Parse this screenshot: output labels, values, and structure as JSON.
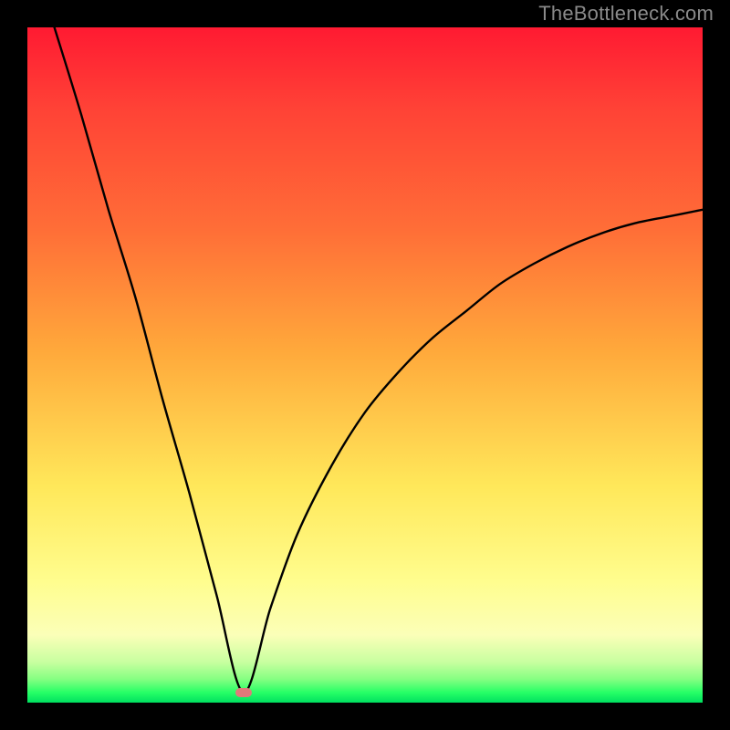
{
  "attribution": "TheBottleneck.com",
  "colors": {
    "background": "#000000",
    "attribution_text": "#8a8a8a",
    "curve": "#000000",
    "min_marker": "#e07a7a",
    "gradient": [
      "#ff1a32",
      "#ff4236",
      "#ff6e37",
      "#ffa93b",
      "#ffe85a",
      "#fffd8e",
      "#fbffb8",
      "#c8ffa0",
      "#86ff82",
      "#26ff66",
      "#00e060"
    ]
  },
  "chart_data": {
    "type": "line",
    "title": "",
    "xlabel": "",
    "ylabel": "",
    "xlim": [
      0,
      100
    ],
    "ylim": [
      0,
      100
    ],
    "min_point": {
      "x": 32,
      "y": 1.5
    },
    "curve_description": "V-shaped bottleneck curve with steep left branch starting at top-left (x≈4, y=100), dipping to minimum at x≈32, y≈1.5, then rising concavely toward top-right (x=100, y≈73).",
    "series": [
      {
        "name": "bottleneck-curve",
        "points": [
          {
            "x": 4,
            "y": 100
          },
          {
            "x": 8,
            "y": 87
          },
          {
            "x": 12,
            "y": 73
          },
          {
            "x": 16,
            "y": 60
          },
          {
            "x": 20,
            "y": 45
          },
          {
            "x": 24,
            "y": 31
          },
          {
            "x": 28,
            "y": 16
          },
          {
            "x": 32,
            "y": 1.5
          },
          {
            "x": 36,
            "y": 14
          },
          {
            "x": 40,
            "y": 25
          },
          {
            "x": 45,
            "y": 35
          },
          {
            "x": 50,
            "y": 43
          },
          {
            "x": 55,
            "y": 49
          },
          {
            "x": 60,
            "y": 54
          },
          {
            "x": 65,
            "y": 58
          },
          {
            "x": 70,
            "y": 62
          },
          {
            "x": 75,
            "y": 65
          },
          {
            "x": 80,
            "y": 67.5
          },
          {
            "x": 85,
            "y": 69.5
          },
          {
            "x": 90,
            "y": 71
          },
          {
            "x": 95,
            "y": 72
          },
          {
            "x": 100,
            "y": 73
          }
        ]
      }
    ]
  }
}
